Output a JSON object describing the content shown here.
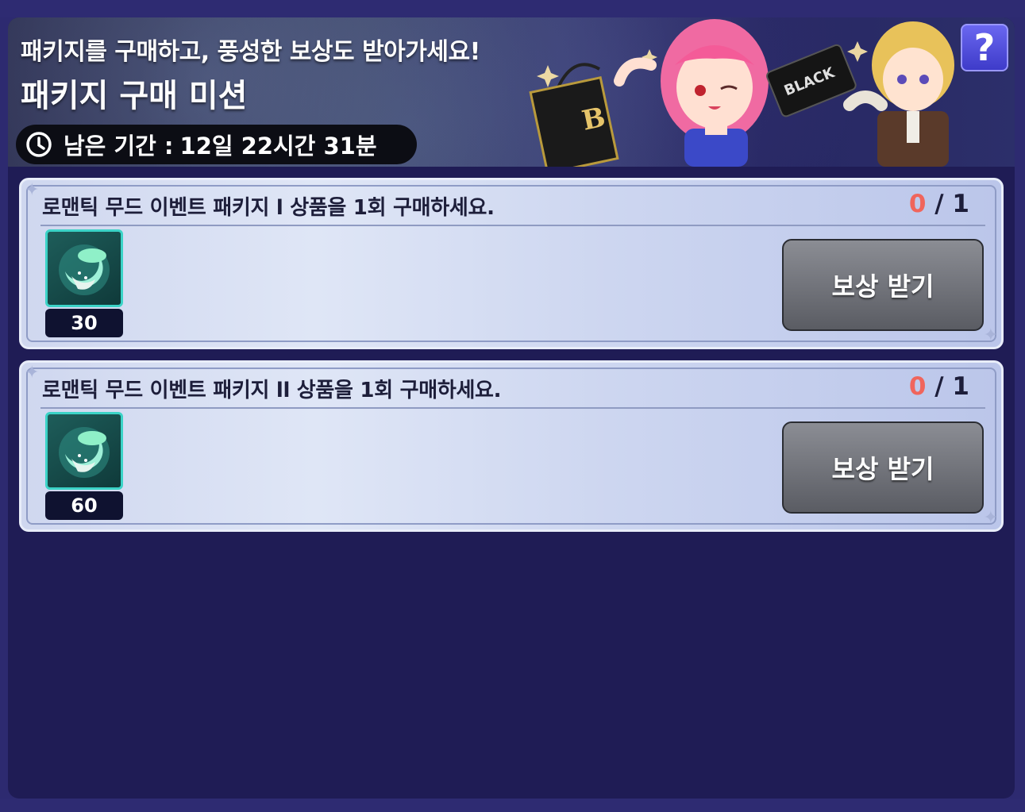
{
  "banner": {
    "subtitle": "패키지를 구매하고, 풍성한 보상도 받아가세요!",
    "title": "패키지 구매 미션",
    "timer_label": "남은 기간 :",
    "timer_value": "12일 22시간 31분",
    "help_label": "?",
    "bag_letter": "B",
    "card_text": "BLACK"
  },
  "missions": [
    {
      "title": "로맨틱 무드 이벤트 패키지 l 상품을 1회 구매하세요.",
      "progress_current": "0",
      "progress_sep": "/",
      "progress_total": "1",
      "reward_qty": "30",
      "button_label": "보상 받기"
    },
    {
      "title": "로맨틱 무드 이벤트 패키지 ll 상품을 1회 구매하세요.",
      "progress_current": "0",
      "progress_sep": "/",
      "progress_total": "1",
      "reward_qty": "60",
      "button_label": "보상 받기"
    }
  ],
  "colors": {
    "background": "#1f1c55",
    "progress_current": "#f0655c",
    "reward_border": "#3bd3c7"
  },
  "icons": [
    "clock-icon",
    "help-icon",
    "reward-item-icon"
  ]
}
